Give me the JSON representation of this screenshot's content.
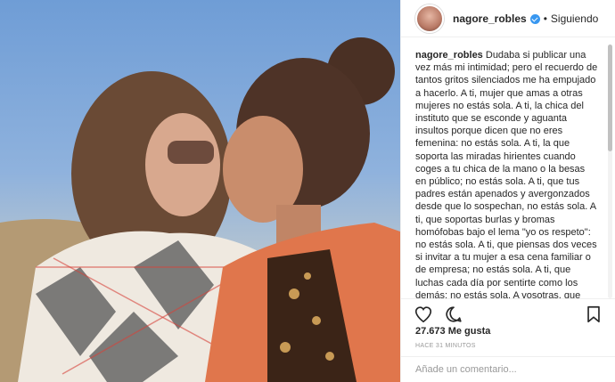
{
  "header": {
    "username": "nagore_robles",
    "separator": "•",
    "follow_status": "Siguiendo"
  },
  "caption": {
    "username": "nagore_robles",
    "text": "Dudaba si publicar una vez más mi intimidad; pero el recuerdo de tantos gritos silenciados me ha empujado a hacerlo. A ti, mujer que amas a otras mujeres no estás sola. A ti, la chica del instituto que se esconde y aguanta insultos porque dicen que no eres femenina: no estás sola. A ti, la que soporta las miradas hirientes cuando coges a tu chica de la mano o la besas en público; no estás sola. A ti, que tus padres están apenados y avergonzados desde que lo sospechan, no estás sola. A ti, que soportas burlas y bromas homófobas bajo el lema \"yo os respeto\": no estás sola. A ti, que piensas dos veces si invitar a tu mujer a esa cena familiar o de empresa; no estás sola. A ti, que luchas cada día por sentirte como los demás; no estás sola. A vosotras, que lleváis al cole a vuestros hijos bajo la"
  },
  "stats": {
    "likes": "27.673 Me gusta",
    "time": "HACE 31 MINUTOS"
  },
  "comment": {
    "placeholder": "Añade un comentario..."
  },
  "icons": [
    "heart-icon",
    "comment-icon",
    "bookmark-icon",
    "verified-badge-icon"
  ],
  "colors": {
    "verified": "#3897f0",
    "border": "#efefef",
    "muted": "#999999"
  }
}
